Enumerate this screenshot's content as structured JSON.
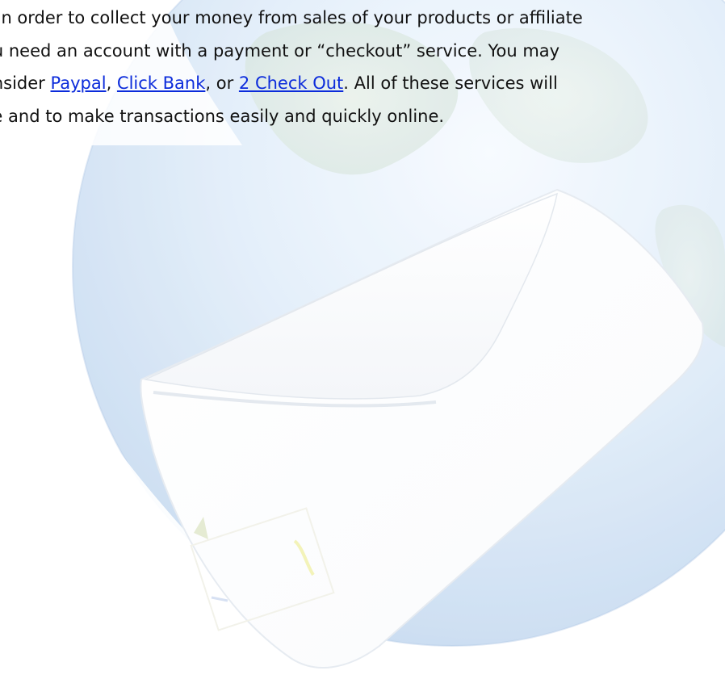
{
  "paragraph": {
    "line1": "s in order to collect your money from sales of your products or affiliate",
    "line2": "ou need an account with a payment or “checkout” service. You may",
    "line3_before": "onsider ",
    "link_paypal": "Paypal",
    "line3_sep1": ", ",
    "link_clickbank": "Click Bank",
    "line3_sep2": ", or ",
    "link_2checkout": "2 Check Out",
    "line3_after": ". All of these services will",
    "line4": "ve and to make transactions easily and quickly online."
  },
  "colors": {
    "text": "#111111",
    "link": "#0b2bdb",
    "globe": "#bcd4ee",
    "envelope": "#ffffff"
  },
  "icons": {
    "background": "globe-with-envelope-watermark"
  }
}
